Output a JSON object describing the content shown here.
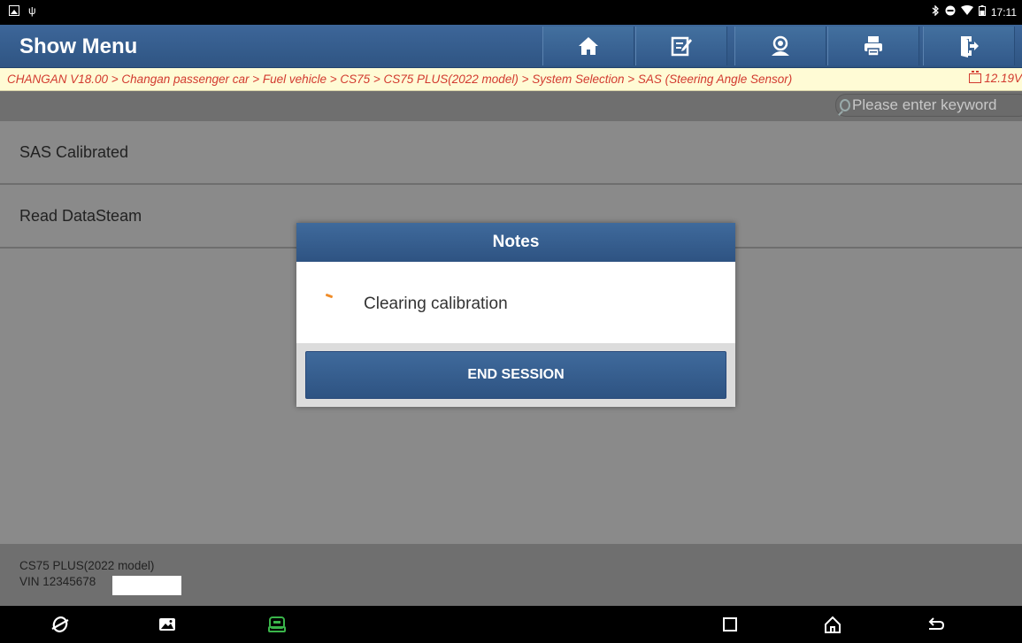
{
  "status_bar": {
    "time": "17:11",
    "left_icons": [
      "image-icon",
      "usb-icon"
    ],
    "right_icons": [
      "bluetooth-icon",
      "dnd-icon",
      "wifi-icon",
      "battery-icon"
    ]
  },
  "header": {
    "title": "Show Menu",
    "buttons": [
      "home-icon",
      "edit-icon",
      "profile-icon",
      "print-icon",
      "exit-icon"
    ]
  },
  "breadcrumb": {
    "path": "CHANGAN V18.00 > Changan passenger car > Fuel vehicle > CS75 > CS75 PLUS(2022 model) > System Selection > SAS (Steering Angle Sensor)",
    "voltage": "12.19V"
  },
  "search": {
    "placeholder": "Please enter keyword"
  },
  "menu": {
    "items": [
      {
        "label": "SAS Calibrated"
      },
      {
        "label": "Read DataSteam"
      }
    ]
  },
  "footer": {
    "model": "CS75 PLUS(2022 model)",
    "vin": "VIN 12345678"
  },
  "dialog": {
    "title": "Notes",
    "message": "Clearing calibration",
    "button": "END SESSION"
  },
  "colors": {
    "header_blue": "#34598a",
    "breadcrumb_text": "#d23a2f",
    "breadcrumb_bg": "#fffbd5",
    "spinner": "#f08c28",
    "vci_green": "#3ab54a"
  }
}
